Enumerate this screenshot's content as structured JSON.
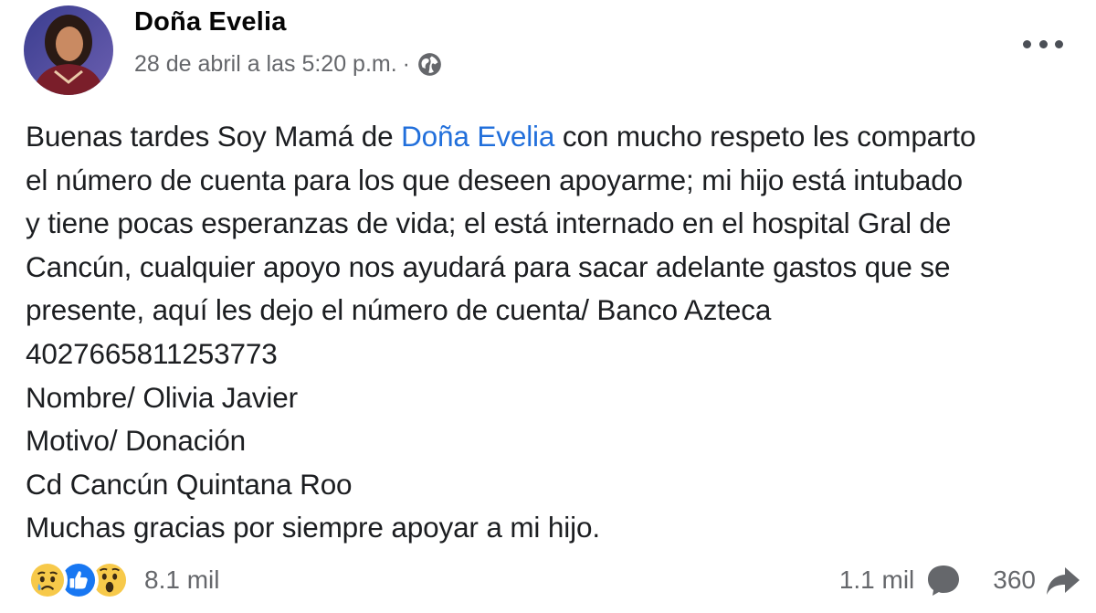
{
  "post": {
    "author": "Doña Evelia",
    "timestamp": "28 de abril a las 5:20 p.m.",
    "separator": "·",
    "privacy_icon": "globe-icon",
    "menu_icon": "more-options-icon",
    "body": {
      "line1_before": "Buenas tardes Soy Mamá de ",
      "line1_mention": "Doña Evelia",
      "line1_after": " con mucho respeto les comparto",
      "lines": [
        "el número de cuenta para los que deseen apoyarme; mi  hijo está intubado",
        "y tiene pocas esperanzas de vida; el está internado en el hospital Gral de",
        "Cancún, cualquier apoyo nos ayudará para sacar adelante gastos que se",
        "presente, aquí les dejo el número de cuenta/ Banco Azteca",
        "4027665811253773",
        "Nombre/ Olivia Javier",
        "Motivo/ Donación",
        "Cd Cancún Quintana Roo",
        "Muchas gracias por siempre apoyar a mi hijo."
      ]
    },
    "reactions": {
      "icons": [
        "sad-reaction-icon",
        "like-reaction-icon",
        "wow-reaction-icon"
      ],
      "count": "8.1 mil"
    },
    "comments": {
      "count": "1.1 mil",
      "icon": "comment-icon"
    },
    "shares": {
      "count": "360",
      "icon": "share-icon"
    },
    "colors": {
      "mention": "#216fdb",
      "secondary_text": "#65676b",
      "like_blue": "#1877f2",
      "emoji_yellow": "#f7c94a"
    }
  }
}
